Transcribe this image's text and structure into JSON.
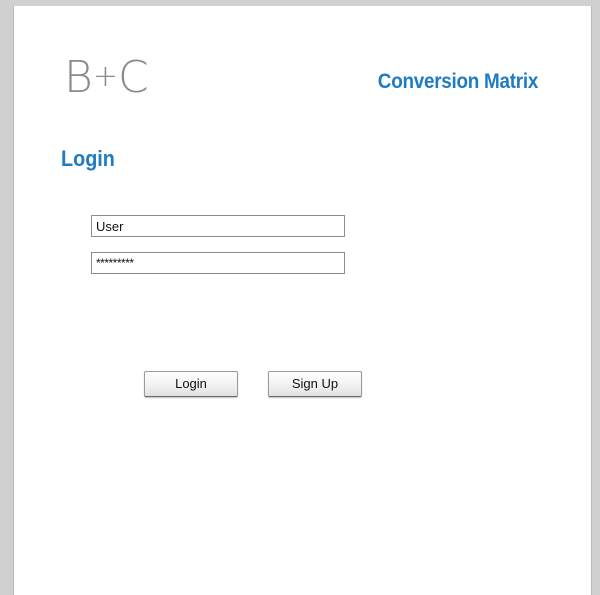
{
  "header": {
    "logo_text": "B+C",
    "logo_left": "B",
    "logo_plus": "+",
    "logo_right": "C",
    "app_title": "Conversion Matrix"
  },
  "page": {
    "heading": "Login"
  },
  "form": {
    "username_value": "User",
    "password_value": "*********"
  },
  "buttons": {
    "login_label": "Login",
    "signup_label": "Sign Up"
  },
  "colors": {
    "accent": "#1f7bc4",
    "logo": "#8a8a8a"
  }
}
